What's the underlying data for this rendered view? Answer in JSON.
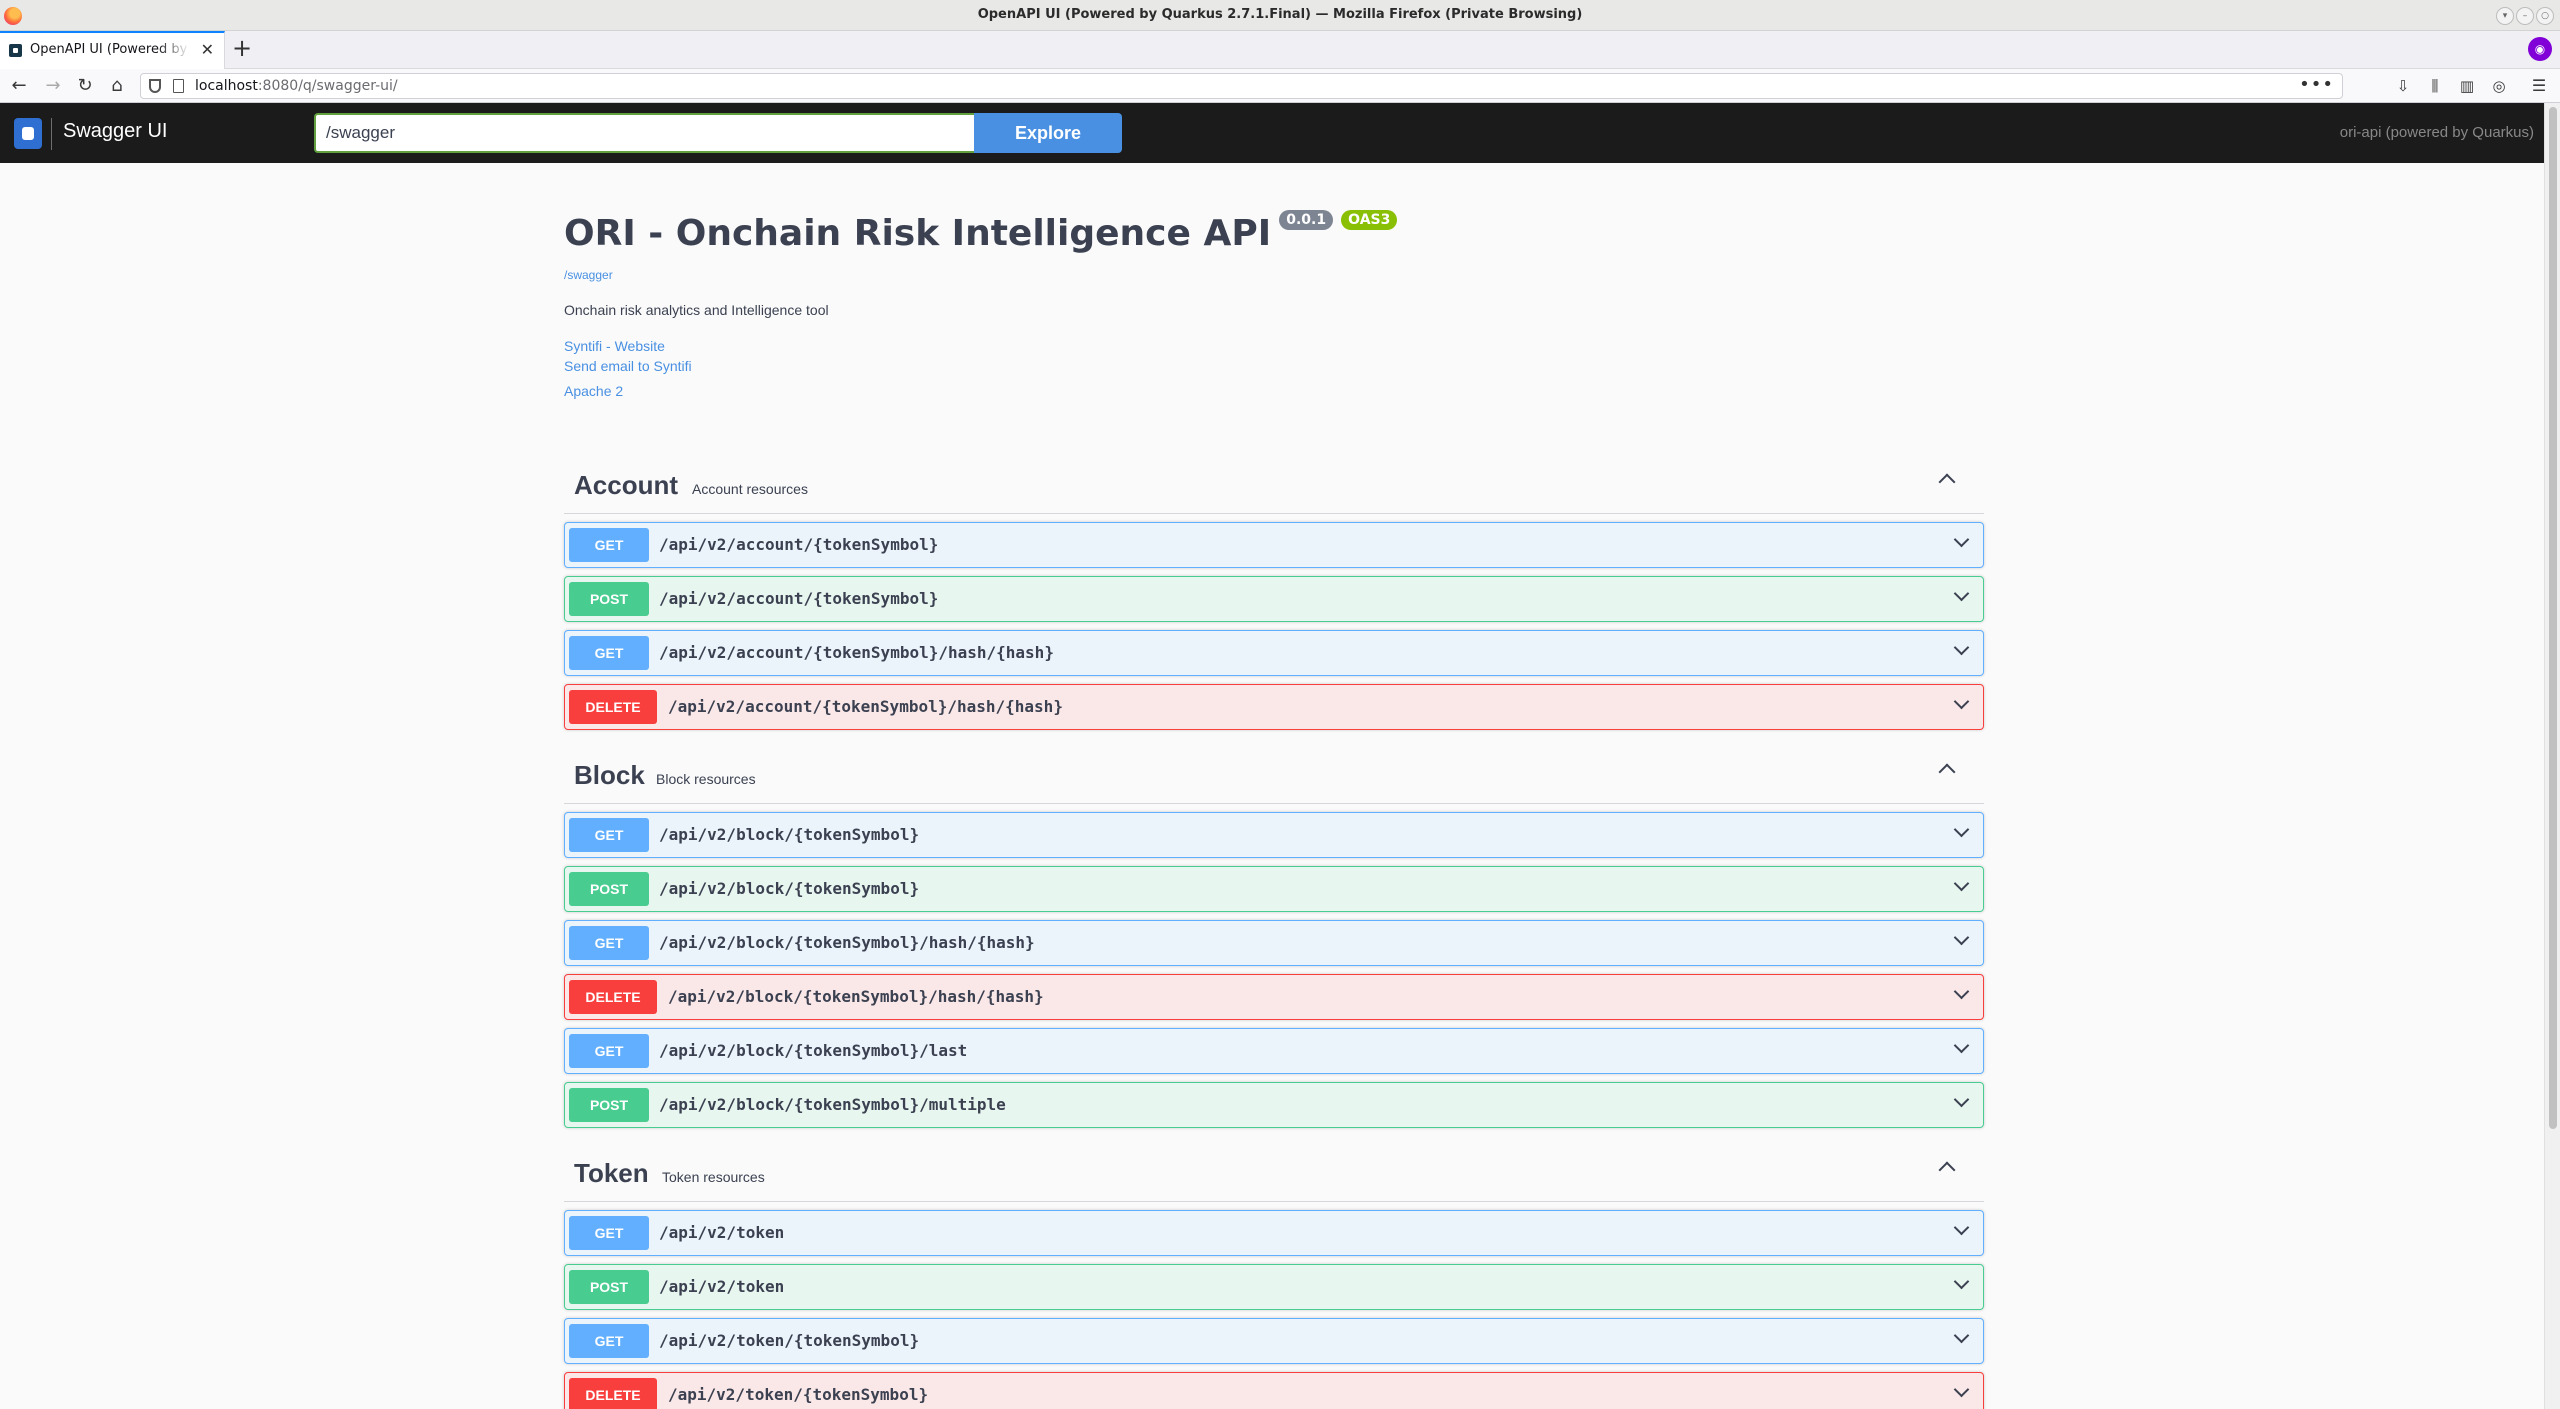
{
  "window": {
    "title": "OpenAPI UI (Powered by Quarkus 2.7.1.Final) — Mozilla Firefox (Private Browsing)"
  },
  "tab": {
    "label": "OpenAPI UI (Powered by",
    "close": "✕",
    "new_tab": "+"
  },
  "nav": {
    "url_host": "localhost",
    "url_rest": ":8080/q/swagger-ui/",
    "more": "•••"
  },
  "swagger": {
    "brand": "Swagger UI",
    "search_value": "/swagger",
    "explore_label": "Explore",
    "right_text": "ori-api (powered by Quarkus)"
  },
  "info": {
    "title": "ORI - Onchain Risk Intelligence API",
    "version": "0.0.1",
    "oas": "OAS3",
    "base_url": "/swagger",
    "description": "Onchain risk analytics and Intelligence tool",
    "links": {
      "website": "Syntifi - Website",
      "email": "Send email to Syntifi",
      "license": "Apache 2"
    }
  },
  "tags": [
    {
      "name": "Account",
      "description": "Account resources",
      "operations": [
        {
          "method": "GET",
          "path": "/api/v2/account/{tokenSymbol}"
        },
        {
          "method": "POST",
          "path": "/api/v2/account/{tokenSymbol}"
        },
        {
          "method": "GET",
          "path": "/api/v2/account/{tokenSymbol}/hash/{hash}"
        },
        {
          "method": "DELETE",
          "path": "/api/v2/account/{tokenSymbol}/hash/{hash}"
        }
      ]
    },
    {
      "name": "Block",
      "description": "Block resources",
      "operations": [
        {
          "method": "GET",
          "path": "/api/v2/block/{tokenSymbol}"
        },
        {
          "method": "POST",
          "path": "/api/v2/block/{tokenSymbol}"
        },
        {
          "method": "GET",
          "path": "/api/v2/block/{tokenSymbol}/hash/{hash}"
        },
        {
          "method": "DELETE",
          "path": "/api/v2/block/{tokenSymbol}/hash/{hash}"
        },
        {
          "method": "GET",
          "path": "/api/v2/block/{tokenSymbol}/last"
        },
        {
          "method": "POST",
          "path": "/api/v2/block/{tokenSymbol}/multiple"
        }
      ]
    },
    {
      "name": "Token",
      "description": "Token resources",
      "operations": [
        {
          "method": "GET",
          "path": "/api/v2/token"
        },
        {
          "method": "POST",
          "path": "/api/v2/token"
        },
        {
          "method": "GET",
          "path": "/api/v2/token/{tokenSymbol}"
        },
        {
          "method": "DELETE",
          "path": "/api/v2/token/{tokenSymbol}"
        }
      ]
    }
  ],
  "colors": {
    "get": "#61affe",
    "post": "#49cc90",
    "delete": "#f93e3e",
    "explore": "#4990e2",
    "topbar": "#1b1b1b"
  }
}
